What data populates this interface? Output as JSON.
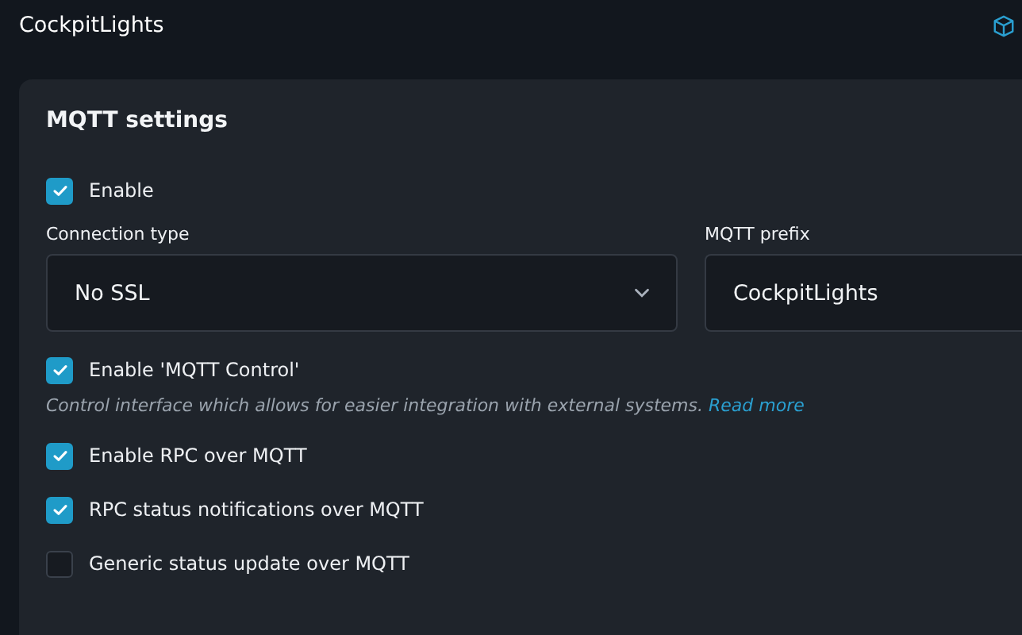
{
  "header": {
    "title": "CockpitLights"
  },
  "card": {
    "title": "MQTT settings",
    "enable": {
      "label": "Enable",
      "checked": true
    },
    "connection_type": {
      "label": "Connection type",
      "value": "No SSL"
    },
    "mqtt_prefix": {
      "label": "MQTT prefix",
      "value": "CockpitLights"
    },
    "options": [
      {
        "label": "Enable 'MQTT Control'",
        "checked": true,
        "description": "Control interface which allows for easier integration with external systems.",
        "link": "Read more"
      },
      {
        "label": "Enable RPC over MQTT",
        "checked": true
      },
      {
        "label": "RPC status notifications over MQTT",
        "checked": true
      },
      {
        "label": "Generic status update over MQTT",
        "checked": false
      }
    ]
  }
}
